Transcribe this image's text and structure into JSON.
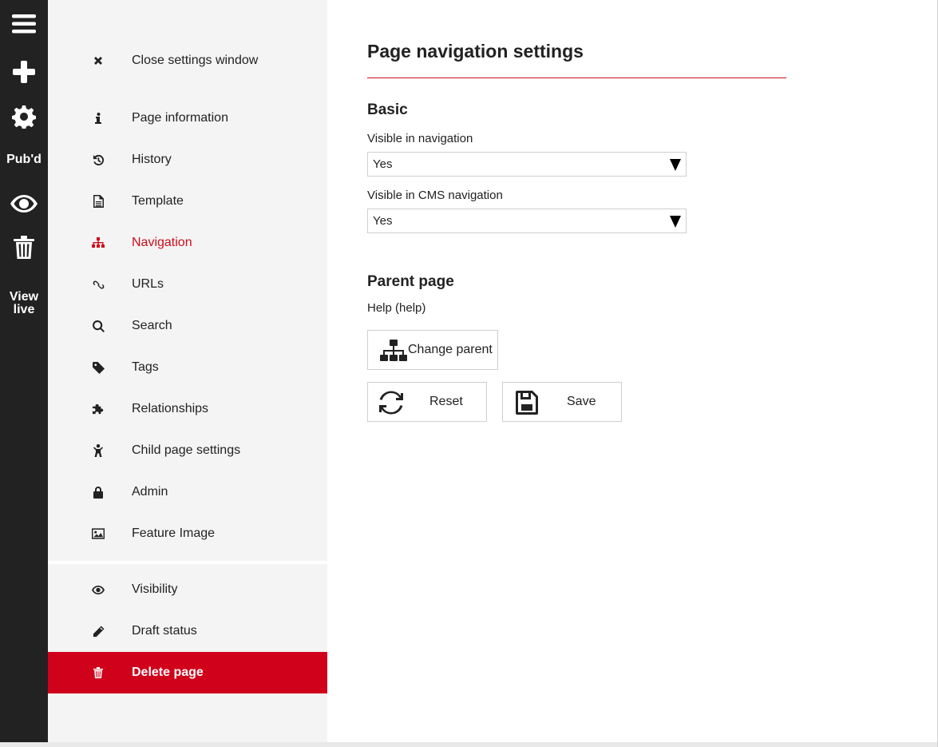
{
  "rail": {
    "menu_icon": "hamburger-menu-icon",
    "add_icon": "plus-icon",
    "settings_icon": "gear-icon",
    "published_label": "Pub'd",
    "preview_icon": "eye-icon",
    "delete_icon": "trash-icon",
    "view_live_line1": "View",
    "view_live_line2": "live"
  },
  "sidebar": {
    "close": {
      "label": "Close settings window",
      "icon": "close-icon"
    },
    "items": [
      {
        "label": "Page information",
        "icon": "info-icon"
      },
      {
        "label": "History",
        "icon": "history-icon"
      },
      {
        "label": "Template",
        "icon": "document-icon"
      },
      {
        "label": "Navigation",
        "icon": "sitemap-icon",
        "active": true
      },
      {
        "label": "URLs",
        "icon": "link-icon"
      },
      {
        "label": "Search",
        "icon": "search-icon"
      },
      {
        "label": "Tags",
        "icon": "tag-icon"
      },
      {
        "label": "Relationships",
        "icon": "puzzle-icon"
      },
      {
        "label": "Child page settings",
        "icon": "child-icon"
      },
      {
        "label": "Admin",
        "icon": "lock-icon"
      },
      {
        "label": "Feature Image",
        "icon": "image-icon"
      }
    ],
    "secondary": [
      {
        "label": "Visibility",
        "icon": "eye-icon"
      },
      {
        "label": "Draft status",
        "icon": "pencil-icon"
      },
      {
        "label": "Delete page",
        "icon": "trash-icon"
      }
    ]
  },
  "main": {
    "title": "Page navigation settings",
    "basic": {
      "heading": "Basic",
      "visible_nav_label": "Visible in navigation",
      "visible_nav_value": "Yes",
      "visible_cms_label": "Visible in CMS navigation",
      "visible_cms_value": "Yes"
    },
    "parent": {
      "heading": "Parent page",
      "value": "Help (help)",
      "change_label": "Change parent"
    },
    "reset_label": "Reset",
    "save_label": "Save"
  },
  "colors": {
    "rail_bg": "#222222",
    "sidebar_bg": "#f4f4f4",
    "accent_red": "#cc0c1b",
    "danger_red": "#d0021b"
  }
}
